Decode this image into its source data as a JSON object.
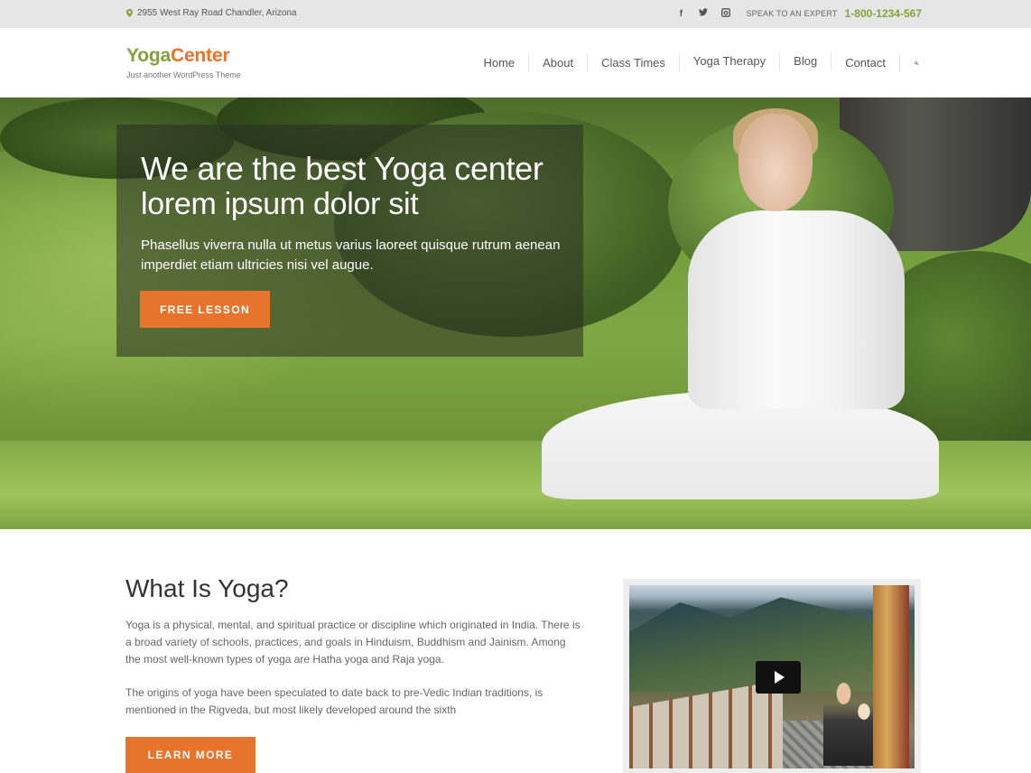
{
  "topbar": {
    "address": "2955 West Ray Road Chandler, Arizona",
    "social": [
      {
        "name": "facebook-icon",
        "glyph": "f"
      },
      {
        "name": "twitter-icon",
        "glyph": "t"
      },
      {
        "name": "instagram-icon",
        "glyph": "◙"
      }
    ],
    "speak_label": "Speak to an expert",
    "phone": "1-800-1234-567"
  },
  "header": {
    "logo_part1": "Yoga",
    "logo_part2": "Center",
    "tagline": "Just another WordPress Theme",
    "nav": [
      {
        "label": "Home"
      },
      {
        "label": "About"
      },
      {
        "label": "Class Times"
      },
      {
        "label": "Yoga Therapy"
      },
      {
        "label": "Blog"
      },
      {
        "label": "Contact"
      }
    ],
    "search_icon": "search-icon"
  },
  "hero": {
    "title": "We are the best Yoga center",
    "subtitle": "lorem ipsum dolor sit",
    "text": "Phasellus viverra nulla ut metus varius laoreet quisque rutrum aenean imperdiet etiam ultricies nisi vel augue.",
    "button": "FREE LESSON"
  },
  "about": {
    "title": "What Is Yoga?",
    "paragraph1": "Yoga is a physical, mental, and spiritual practice or discipline which originated in India. There is a broad variety of schools, practices, and goals in Hinduism, Buddhism and Jainism. Among the most well-known types of yoga are Hatha yoga and Raja yoga.",
    "paragraph2": "The origins of yoga have been speculated to date back to pre-Vedic Indian traditions, is mentioned in the Rigveda, but most likely developed around the sixth",
    "button": "LEARN MORE"
  },
  "video": {
    "play_icon": "play-icon"
  },
  "colors": {
    "accent_orange": "#e8732a",
    "brand_green": "#84a03d",
    "phone_green": "#8aa03a"
  }
}
